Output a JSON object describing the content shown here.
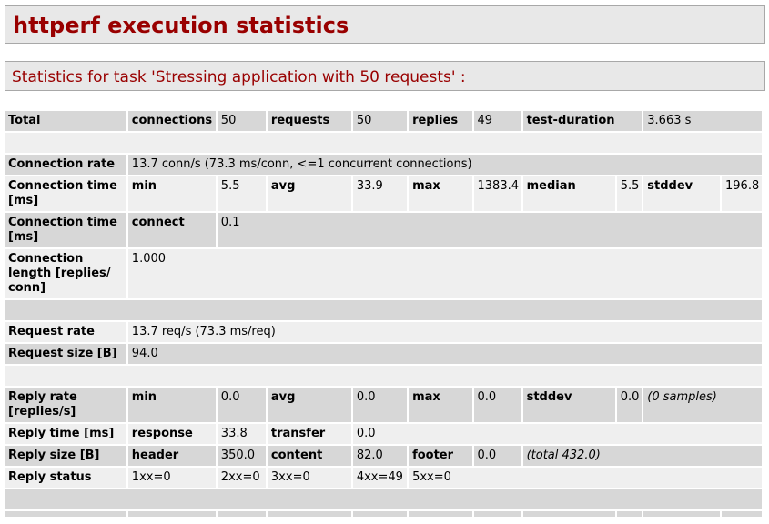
{
  "page_title": "httperf execution statistics",
  "task_title": "Statistics for task 'Stressing application with 50 requests' :",
  "total": {
    "label": "Total",
    "k1": "connections",
    "v1": "50",
    "k2": "requests",
    "v2": "50",
    "k3": "replies",
    "v3": "49",
    "k4": "test-duration",
    "v4": "3.663 s"
  },
  "connection_rate": {
    "label": "Connection rate",
    "value": "13.7 conn/s (73.3 ms/conn, <=1 concurrent connections)"
  },
  "connection_time": {
    "label": "Connection time [ms]",
    "k1": "min",
    "v1": "5.5",
    "k2": "avg",
    "v2": "33.9",
    "k3": "max",
    "v3": "1383.4",
    "k4": "median",
    "v4": "5.5",
    "k5": "stddev",
    "v5": "196.8"
  },
  "connection_time_connect": {
    "label": "Connection time [ms]",
    "k1": "connect",
    "v1": "0.1"
  },
  "connection_length": {
    "label": "Connection length [replies/ conn]",
    "value": "1.000"
  },
  "request_rate": {
    "label": "Request rate",
    "value": "13.7 req/s (73.3 ms/req)"
  },
  "request_size": {
    "label": "Request size [B]",
    "value": "94.0"
  },
  "reply_rate": {
    "label": "Reply rate [replies/s]",
    "k1": "min",
    "v1": "0.0",
    "k2": "avg",
    "v2": "0.0",
    "k3": "max",
    "v3": "0.0",
    "k4": "stddev",
    "v4": "0.0",
    "note": "(0 samples)"
  },
  "reply_time": {
    "label": "Reply time [ms]",
    "k1": "response",
    "v1": "33.8",
    "k2": "transfer",
    "v2": "0.0"
  },
  "reply_size": {
    "label": "Reply size [B]",
    "k1": "header",
    "v1": "350.0",
    "k2": "content",
    "v2": "82.0",
    "k3": "footer",
    "v3": "0.0",
    "note": "(total 432.0)"
  },
  "reply_status": {
    "label": "Reply status",
    "s1": "1xx=0",
    "s2": "2xx=0",
    "s3": "3xx=0",
    "s4": "4xx=49",
    "s5": "5xx=0"
  }
}
